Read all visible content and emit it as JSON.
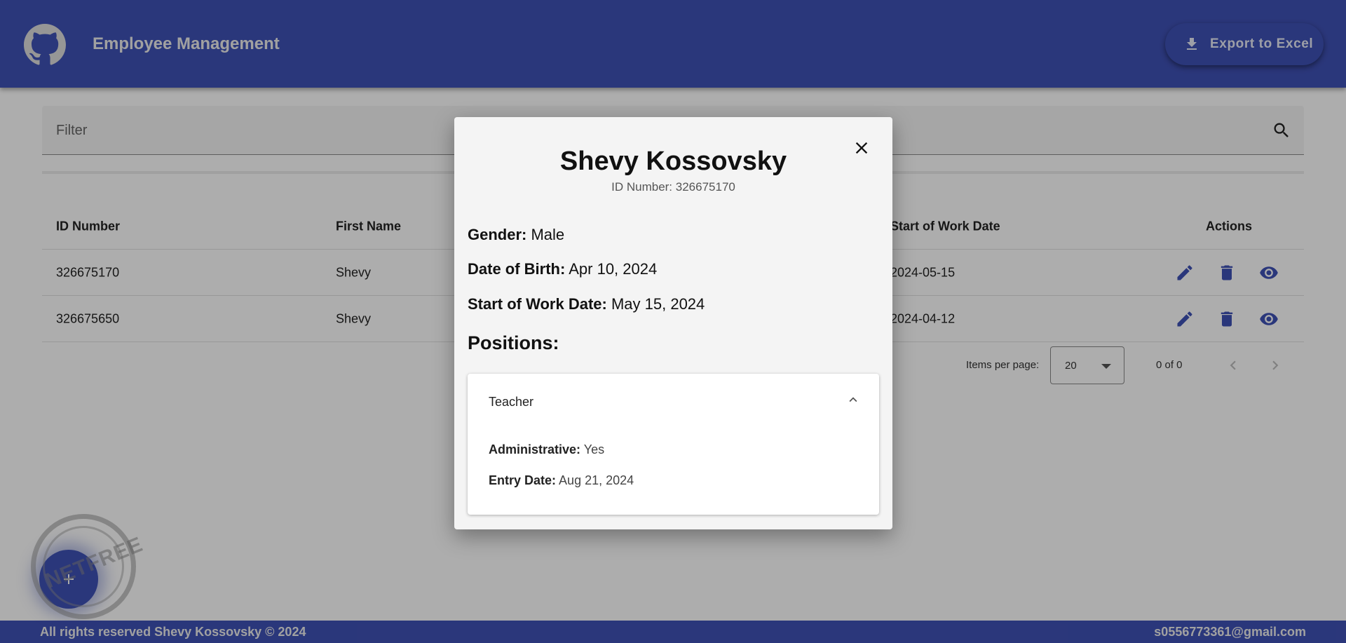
{
  "header": {
    "title": "Employee Management",
    "export_label": "Export to Excel",
    "color": "#3f51b5"
  },
  "filter": {
    "label": "Filter"
  },
  "table": {
    "columns": {
      "id": "ID Number",
      "first_name": "First Name",
      "start_date": "Start of Work Date",
      "actions": "Actions"
    },
    "rows": [
      {
        "id": "326675170",
        "first_name": "Shevy",
        "start_date": "2024-05-15"
      },
      {
        "id": "326675650",
        "first_name": "Shevy",
        "start_date": "2024-04-12"
      }
    ],
    "action_icons": [
      "edit-icon",
      "delete-icon",
      "view-icon"
    ]
  },
  "paginator": {
    "label": "Items per page:",
    "page_size": "20",
    "range": "0 of 0"
  },
  "watermark": {
    "text": "NETFREE"
  },
  "footer": {
    "left": "All rights reserved Shevy Kossovsky © 2024",
    "right": "s0556773361@gmail.com"
  },
  "dialog": {
    "name": "Shevy Kossovsky",
    "id_line": "ID Number: 326675170",
    "gender_label": "Gender:",
    "gender": "Male",
    "dob_label": "Date of Birth:",
    "dob": "Apr 10, 2024",
    "start_label": "Start of Work Date:",
    "start": "May 15, 2024",
    "positions_title": "Positions:",
    "positions": [
      {
        "title": "Teacher",
        "admin_label": "Administrative:",
        "admin": "Yes",
        "entry_label": "Entry Date:",
        "entry": "Aug 21, 2024"
      }
    ]
  }
}
